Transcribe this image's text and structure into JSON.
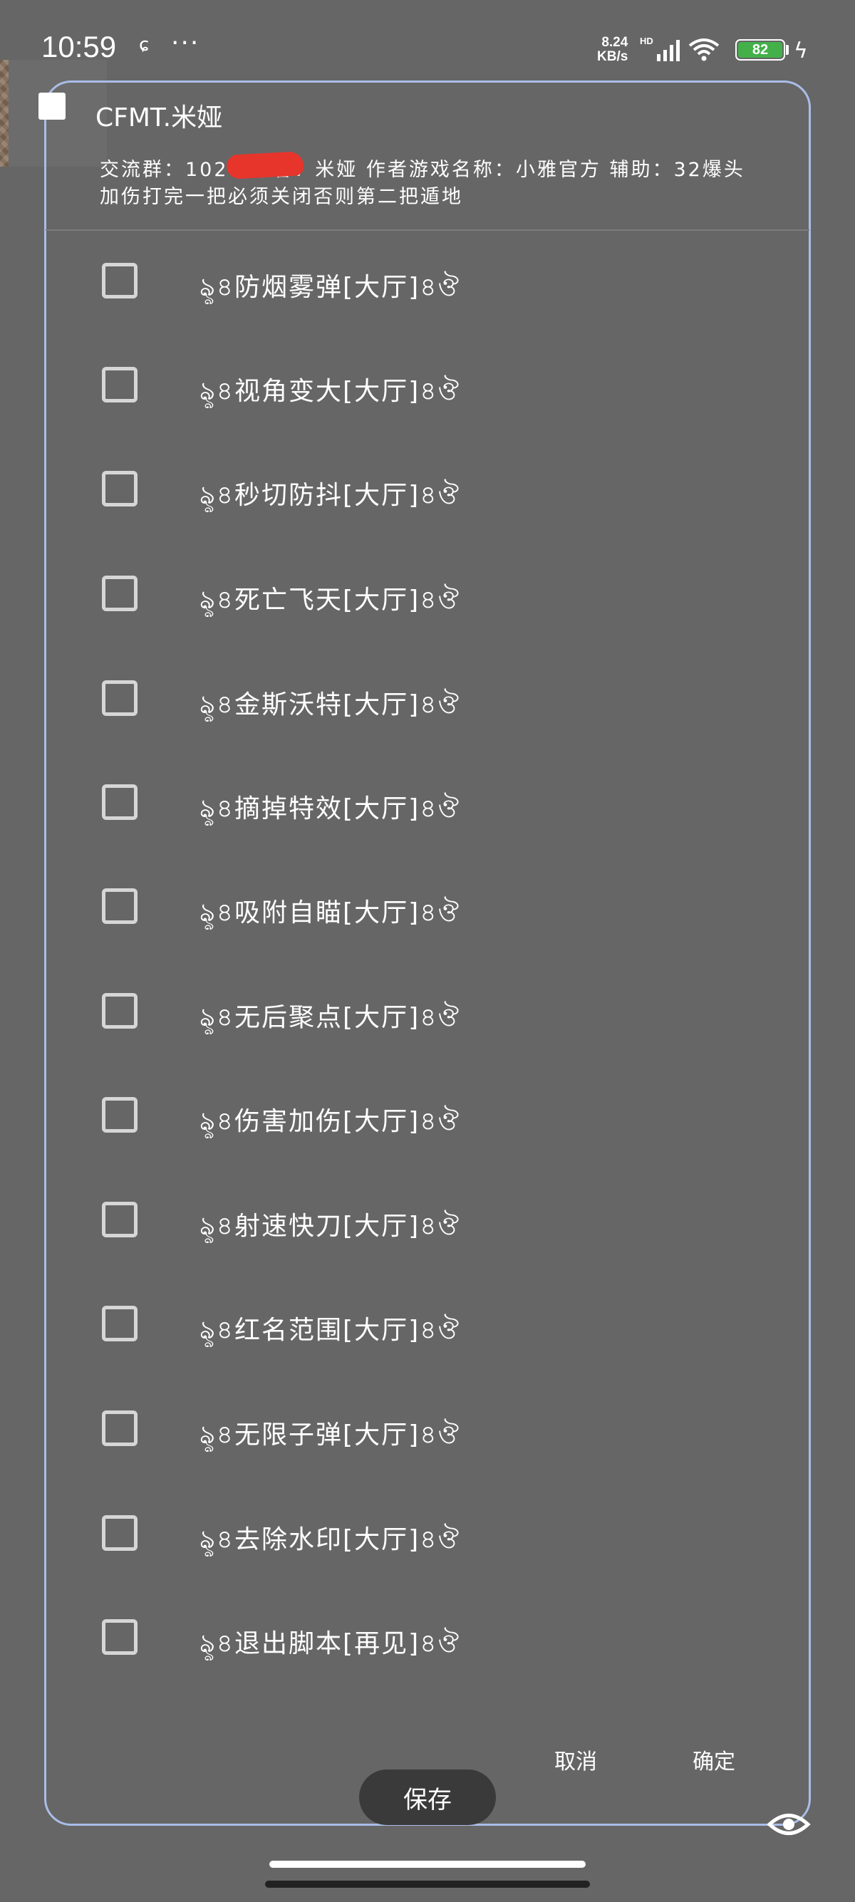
{
  "status_bar": {
    "time": "10:59",
    "net_speed_value": "8.24",
    "net_speed_unit": "KB/s",
    "hd": "HD",
    "battery": "82"
  },
  "dialog": {
    "title": "CFMT.米娅",
    "subtitle": "交流群：1020 作者：米娅 作者游戏名称：小雅官方 辅助：32爆头加伤打完一把必须关闭否则第二把遁地",
    "options": [
      {
        "label": "ৡ৪防烟雾弹[大厅]৪ঔ"
      },
      {
        "label": "ৡ৪视角变大[大厅]৪ঔ"
      },
      {
        "label": "ৡ৪秒切防抖[大厅]৪ঔ"
      },
      {
        "label": "ৡ৪死亡飞天[大厅]৪ঔ"
      },
      {
        "label": "ৡ৪金斯沃特[大厅]৪ঔ"
      },
      {
        "label": "ৡ৪摘掉特效[大厅]৪ঔ"
      },
      {
        "label": "ৡ৪吸附自瞄[大厅]৪ঔ"
      },
      {
        "label": "ৡ৪无后聚点[大厅]৪ঔ"
      },
      {
        "label": "ৡ৪伤害加伤[大厅]৪ঔ"
      },
      {
        "label": "ৡ৪射速快刀[大厅]৪ঔ"
      },
      {
        "label": "ৡ৪红名范围[大厅]৪ঔ"
      },
      {
        "label": "ৡ৪无限子弹[大厅]৪ঔ"
      },
      {
        "label": "ৡ৪去除水印[大厅]৪ঔ"
      },
      {
        "label": "ৡ৪退出脚本[再见]৪ঔ"
      }
    ],
    "cancel_label": "取消",
    "confirm_label": "确定"
  },
  "save_label": "保存"
}
